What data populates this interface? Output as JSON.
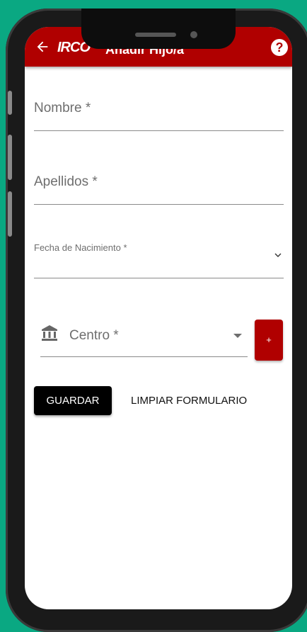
{
  "appbar": {
    "logo": "IRCO",
    "title": "Añadir Hijo/a",
    "help_symbol": "?"
  },
  "form": {
    "nombre_placeholder": "Nombre *",
    "apellidos_placeholder": "Apellidos *",
    "fecha_label": "Fecha de Nacimiento *",
    "centro_placeholder": "Centro *",
    "add_centro_label": "+",
    "save_label": "GUARDAR",
    "clear_label": "LIMPIAR FORMULARIO"
  },
  "colors": {
    "brand": "#b00000",
    "background": "#0aa882",
    "primary_button": "#000000"
  },
  "icons": [
    "back-arrow-icon",
    "help-icon",
    "chevron-down-icon",
    "bank-icon",
    "dropdown-caret-icon"
  ]
}
